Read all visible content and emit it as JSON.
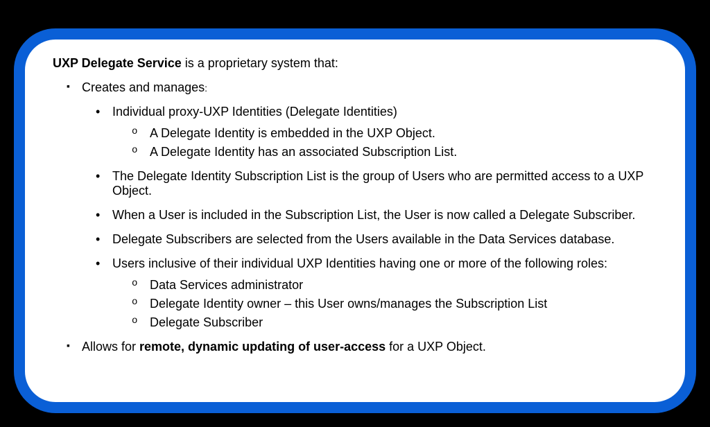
{
  "intro": {
    "title": "UXP Delegate Service",
    "suffix": " is a proprietary system that:"
  },
  "bullets": {
    "b1": {
      "text": "Creates and manages",
      "colon": ":",
      "sub": {
        "s1": {
          "text": "Individual proxy-UXP Identities (Delegate Identities)",
          "sub": {
            "t1": "A Delegate Identity is embedded in the UXP Object.",
            "t2": "A Delegate Identity has an associated Subscription List."
          }
        },
        "s2": "The Delegate Identity Subscription List is the group of Users who are permitted access to a UXP Object.",
        "s3": "When a User is included in the Subscription List, the User is now called a Delegate Subscriber.",
        "s4": "Delegate Subscribers are selected from the Users available in the Data Services database.",
        "s5": {
          "text": "Users inclusive of their individual UXP Identities having one or more of the following roles:",
          "sub": {
            "t1": "Data Services administrator",
            "t2": "Delegate Identity owner – this User owns/manages the Subscription List",
            "t3": "Delegate Subscriber"
          }
        }
      }
    },
    "b2": {
      "prefix": "Allows for ",
      "bold": "remote, dynamic updating of user-access",
      "suffix": " for a UXP Object."
    }
  }
}
